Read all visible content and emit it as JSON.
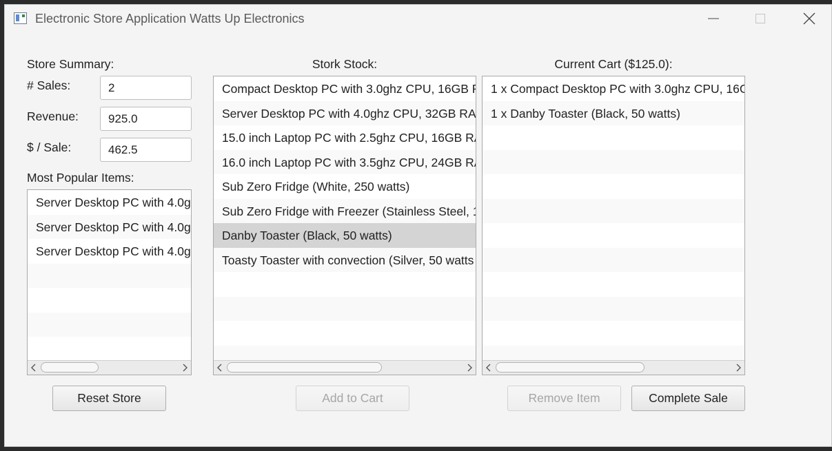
{
  "window": {
    "title": "Electronic Store Application Watts Up Electronics"
  },
  "summary": {
    "heading": "Store Summary:",
    "sales_label": "# Sales:",
    "sales_value": "2",
    "revenue_label": "Revenue:",
    "revenue_value": "925.0",
    "per_sale_label": "$ / Sale:",
    "per_sale_value": "462.5"
  },
  "popular": {
    "heading": "Most Popular Items:",
    "items": [
      "Server Desktop PC with 4.0g",
      "Server Desktop PC with 4.0g",
      "Server Desktop PC with 4.0g"
    ]
  },
  "stock": {
    "heading": "Stork Stock:",
    "items": [
      "Compact Desktop PC with 3.0ghz CPU, 16GB R",
      "Server Desktop PC with 4.0ghz CPU, 32GB RAM",
      "15.0 inch Laptop PC with 2.5ghz CPU, 16GB RA",
      "16.0 inch Laptop PC with 3.5ghz CPU, 24GB RA",
      "Sub Zero Fridge (White, 250 watts)",
      "Sub Zero Fridge with Freezer (Stainless Steel, 1",
      "Danby Toaster (Black, 50 watts)",
      "Toasty Toaster with convection (Silver, 50 watts"
    ],
    "selected_index": 6
  },
  "cart": {
    "heading": "Current Cart ($125.0):",
    "items": [
      "1 x Compact Desktop PC with 3.0ghz CPU, 16G",
      "1 x Danby Toaster (Black, 50 watts)"
    ]
  },
  "buttons": {
    "reset": "Reset Store",
    "add": "Add to Cart",
    "remove": "Remove Item",
    "complete": "Complete Sale"
  },
  "colors": {
    "window_bg": "#f4f4f4",
    "selected_row": "#d4d4d4",
    "alt_row": "#f9f9f9",
    "disabled_text": "#a6a6a6"
  }
}
